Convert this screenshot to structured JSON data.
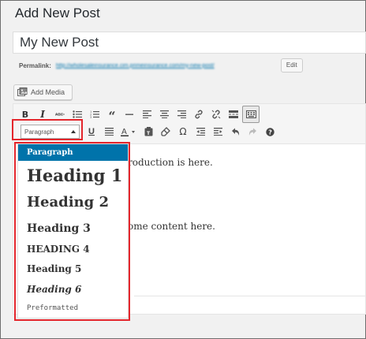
{
  "page": {
    "title": "Add New Post"
  },
  "post": {
    "title_value": "My New Post",
    "permalink_label": "Permalink:",
    "permalink_url": "http://wholesaleinsurance.cim.primeinsurance.com/my-new-post/",
    "edit_label": "Edit"
  },
  "media": {
    "add_media_label": "Add Media"
  },
  "toolbar": {
    "row1": [
      "bold-icon",
      "italic-icon",
      "strikethrough-icon",
      "bulleted-list-icon",
      "numbered-list-icon",
      "blockquote-icon",
      "horizontal-line-icon",
      "align-left-icon",
      "align-center-icon",
      "align-right-icon",
      "link-icon",
      "unlink-icon",
      "read-more-icon",
      "toolbar-toggle-icon"
    ],
    "row2": [
      "underline-icon",
      "justify-icon",
      "text-color-icon",
      "paste-text-icon",
      "clear-formatting-icon",
      "special-character-icon",
      "outdent-icon",
      "indent-icon",
      "undo-icon",
      "redo-icon",
      "help-icon"
    ],
    "format_select_value": "Paragraph"
  },
  "content": {
    "line1": "roduction is here.",
    "line2": "ome content here."
  },
  "format_dropdown": {
    "items": [
      "Paragraph",
      "Heading 1",
      "Heading 2",
      "Heading 3",
      "HEADING 4",
      "Heading 5",
      "Heading 6",
      "Preformatted"
    ],
    "selected": "Paragraph"
  },
  "colors": {
    "accent": "#0073aa",
    "highlight_border": "#e4262c"
  }
}
